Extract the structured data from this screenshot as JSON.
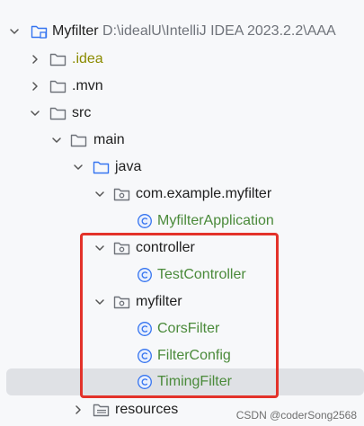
{
  "root": {
    "name": "Myfilter",
    "path": "D:\\idealU\\IntelliJ IDEA 2023.2.2\\AAA"
  },
  "items": {
    "idea": ".idea",
    "mvn": ".mvn",
    "src": "src",
    "main": "main",
    "java": "java",
    "package": "com.example.myfilter",
    "app_class": "MyfilterApplication",
    "controller_pkg": "controller",
    "controller_class": "TestController",
    "myfilter_pkg": "myfilter",
    "cors": "CorsFilter",
    "filter_config": "FilterConfig",
    "timing": "TimingFilter",
    "resources": "resources"
  },
  "watermark": "CSDN @coderSong2568",
  "colors": {
    "folder_blue": "#3574f0",
    "class_green": "#4a8a3a",
    "idea_olive": "#8b8b00",
    "highlight_red": "#e3322a"
  },
  "icons": {
    "collapsed": "chevron-right-icon",
    "expanded": "chevron-down-icon",
    "folder": "folder-icon",
    "package": "package-icon",
    "class": "class-icon"
  }
}
